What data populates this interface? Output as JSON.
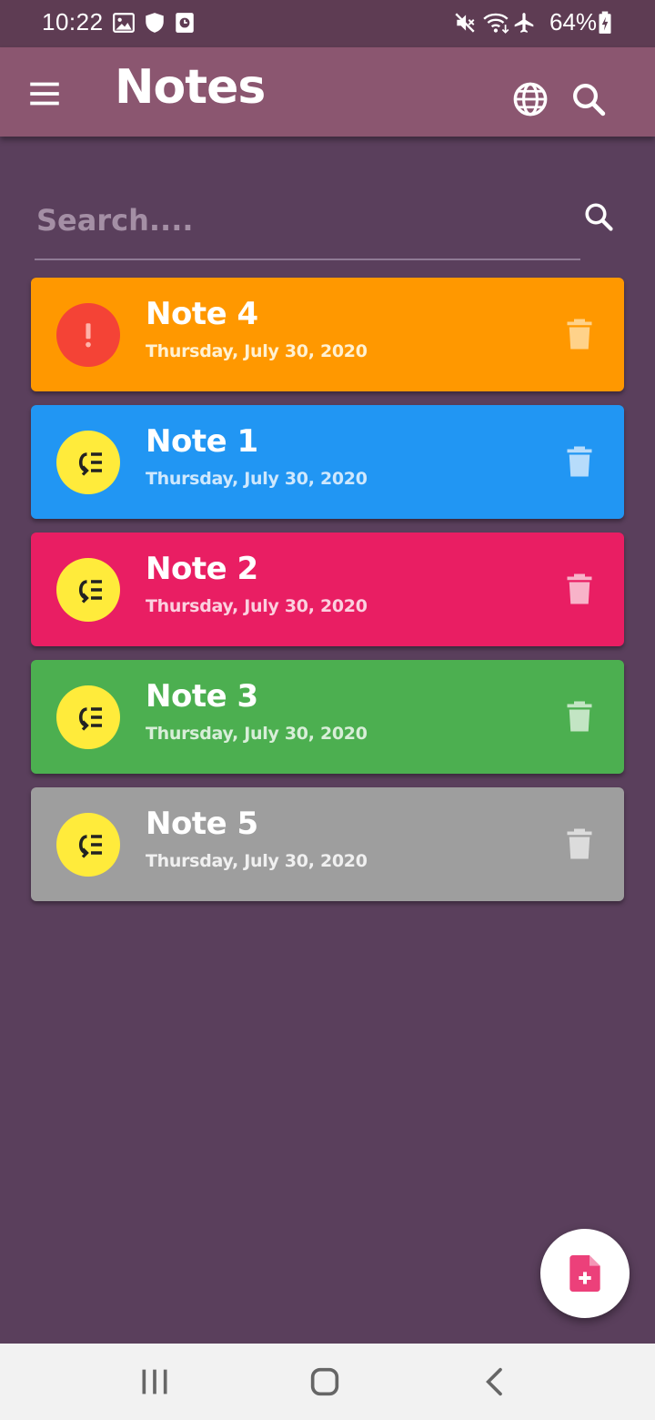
{
  "status_bar": {
    "time": "10:22",
    "battery_percent": "64%",
    "icons": [
      "image-icon",
      "shield-icon",
      "clock-box-icon",
      "mute-icon",
      "wifi-icon",
      "airplane-icon",
      "battery-charging-icon"
    ]
  },
  "app_bar": {
    "title": "Notes",
    "icons": [
      "menu-icon",
      "globe-icon",
      "search-icon"
    ]
  },
  "search": {
    "placeholder": "Search....",
    "value": ""
  },
  "notes": [
    {
      "title": "Note 4",
      "date": "Thursday, July 30, 2020",
      "color": "#ff9800",
      "date_color": "#fff1d2",
      "badge": "priority-high-icon",
      "badge_color": "#f44336",
      "delete_color": "#ffd28a"
    },
    {
      "title": "Note 1",
      "date": "Thursday, July 30, 2020",
      "color": "#2196f3",
      "date_color": "#cfe8fd",
      "badge": "low-priority-icon",
      "badge_color": "#ffeb3b",
      "delete_color": "#b7dcfb"
    },
    {
      "title": "Note 2",
      "date": "Thursday, July 30, 2020",
      "color": "#e91e63",
      "date_color": "#fbd0df",
      "badge": "low-priority-icon",
      "badge_color": "#ffeb3b",
      "delete_color": "#f8b3c9"
    },
    {
      "title": "Note 3",
      "date": "Thursday, July 30, 2020",
      "color": "#4caf50",
      "date_color": "#d8eed8",
      "badge": "low-priority-icon",
      "badge_color": "#ffeb3b",
      "delete_color": "#c3e5c4"
    },
    {
      "title": "Note 5",
      "date": "Thursday, July 30, 2020",
      "color": "#9e9e9e",
      "date_color": "#f0f0f0",
      "badge": "low-priority-icon",
      "badge_color": "#ffeb3b",
      "delete_color": "#dcdcdc"
    }
  ],
  "fab": {
    "icon": "add-note-icon",
    "color": "#ec407a"
  },
  "nav_bar": {
    "icons": [
      "recent-apps-icon",
      "home-icon",
      "back-icon"
    ]
  },
  "colors": {
    "background": "#5a3f5c",
    "app_bar": "#8b5670",
    "status_bar": "#5e3c53"
  }
}
